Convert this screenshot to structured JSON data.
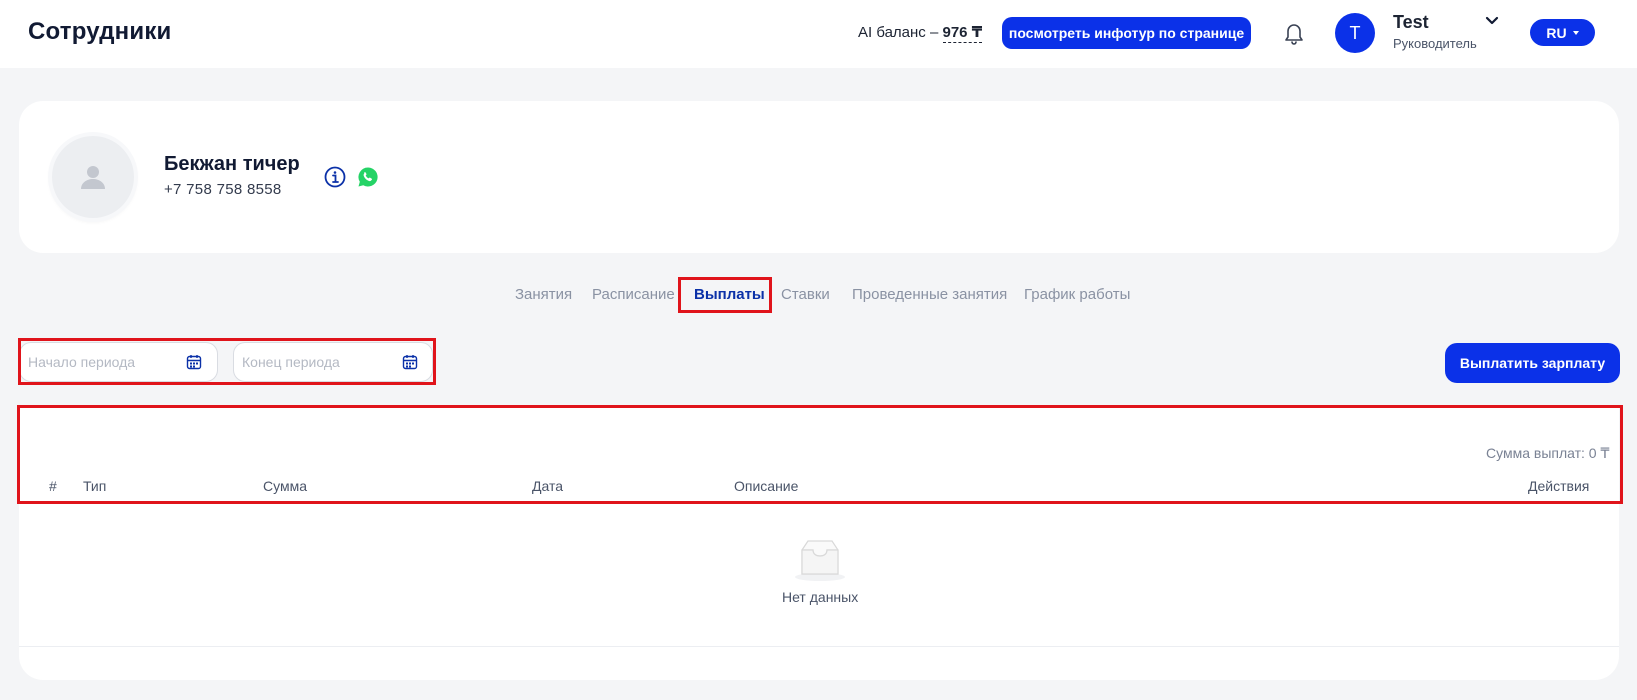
{
  "header": {
    "title": "Сотрудники",
    "ai_balance_label": "AI баланс –",
    "ai_balance_value": "976 ₸",
    "tour_button": "посмотреть инфотур по странице",
    "user": {
      "avatar_letter": "T",
      "name": "Test",
      "role": "Руководитель"
    },
    "language": "RU"
  },
  "profile": {
    "name": "Бекжан тичер",
    "phone": "+7 758 758 8558"
  },
  "tabs": [
    {
      "label": "Занятия",
      "active": false
    },
    {
      "label": "Расписание",
      "active": false
    },
    {
      "label": "Выплаты",
      "active": true
    },
    {
      "label": "Ставки",
      "active": false
    },
    {
      "label": "Проведенные занятия",
      "active": false
    },
    {
      "label": "График работы",
      "active": false
    }
  ],
  "filters": {
    "start_placeholder": "Начало периода",
    "end_placeholder": "Конец периода"
  },
  "pay_button": "Выплатить зарплату",
  "table": {
    "sum_label": "Сумма выплат: 0 ₸",
    "columns": [
      "#",
      "Тип",
      "Сумма",
      "Дата",
      "Описание",
      "Действия"
    ],
    "empty_text": "Нет данных",
    "rows": []
  },
  "colors": {
    "accent": "#0b31e8",
    "highlight_border": "#e0141b",
    "whatsapp": "#25d366"
  }
}
